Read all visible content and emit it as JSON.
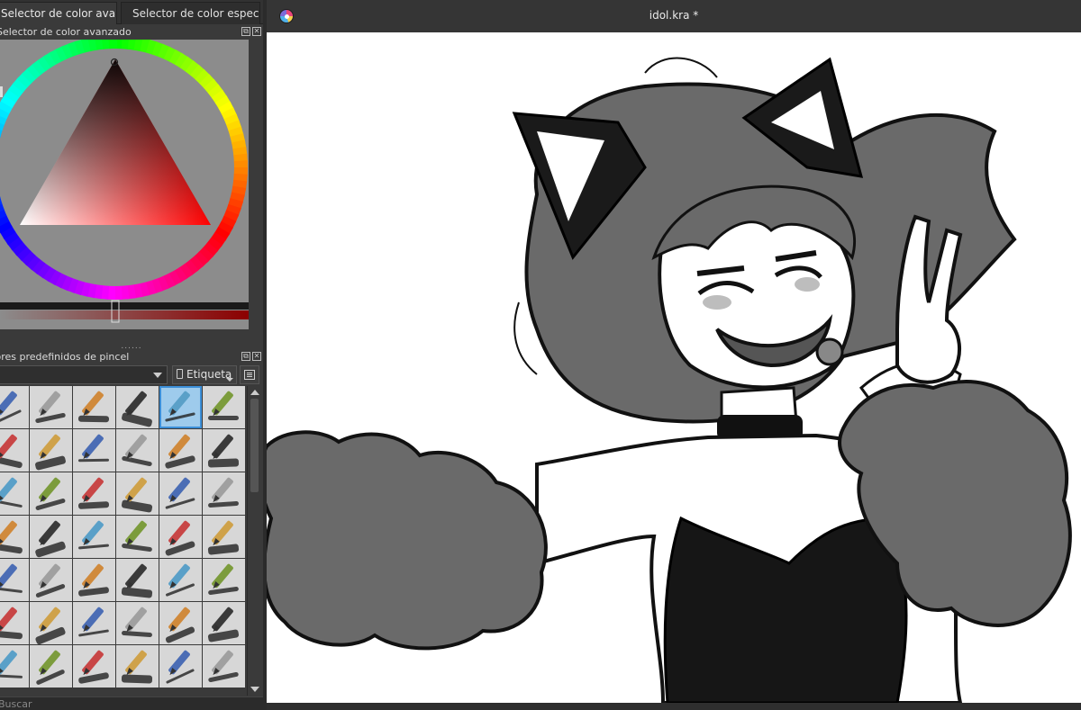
{
  "dock": {
    "tabs": [
      {
        "label": "Selector de color avanza..."
      },
      {
        "label": "Selector de color especifi..."
      }
    ],
    "color_selector": {
      "title": "Selector de color avanzado",
      "ring_colors": [
        "#ff0000",
        "#ffff00",
        "#00ff00",
        "#00ffff",
        "#0000ff",
        "#ff00ff"
      ],
      "triangle_hue": "#ff0000",
      "background": "#8c8c8c"
    },
    "presets": {
      "title": "Valores predefinidos de pincel",
      "tag_label": "Etiqueta",
      "search_placeholder": "Buscar",
      "selected_index": 4,
      "items": [
        {
          "name": "eraser"
        },
        {
          "name": "marker-blue"
        },
        {
          "name": "smudge"
        },
        {
          "name": "airbrush"
        },
        {
          "name": "pen-blue"
        },
        {
          "name": "ink-pen"
        },
        {
          "name": "pencil"
        },
        {
          "name": "pencil-2"
        },
        {
          "name": "ink-brush"
        },
        {
          "name": "brush-orange"
        },
        {
          "name": "brush-fine"
        },
        {
          "name": "pencil-blue"
        },
        {
          "name": "pencil-3"
        },
        {
          "name": "pencil-4"
        },
        {
          "name": "pen-curve"
        },
        {
          "name": "brush-rough"
        },
        {
          "name": "crayon-green"
        },
        {
          "name": "texture"
        },
        {
          "name": "pen-5"
        },
        {
          "name": "marker-yellow"
        },
        {
          "name": "brush-soft"
        },
        {
          "name": "brush-flat"
        },
        {
          "name": "brush-dry"
        },
        {
          "name": "pen-blue-2"
        },
        {
          "name": "marker-red"
        },
        {
          "name": "marker-cyan"
        },
        {
          "name": "brush-green"
        },
        {
          "name": "brush-wet"
        },
        {
          "name": "brush-paint"
        },
        {
          "name": "brush-bristle"
        },
        {
          "name": "chalk"
        },
        {
          "name": "charcoal"
        },
        {
          "name": "roller"
        },
        {
          "name": "brush-texture"
        },
        {
          "name": "brush-splat"
        },
        {
          "name": "brush-dust"
        },
        {
          "name": "stamp"
        },
        {
          "name": "crayon"
        },
        {
          "name": "brush-copper"
        },
        {
          "name": "brush-gold"
        },
        {
          "name": "pen-dark"
        },
        {
          "name": "brush-brown"
        }
      ],
      "tool_colors": [
        "#4b6db5",
        "#a0a0a0",
        "#d08a3c",
        "#3a3a3a",
        "#5aa0c8",
        "#7c9c3c",
        "#c84646",
        "#cfa24a"
      ]
    }
  },
  "document": {
    "title": "idol.kra *",
    "canvas_background": "#ffffff"
  }
}
